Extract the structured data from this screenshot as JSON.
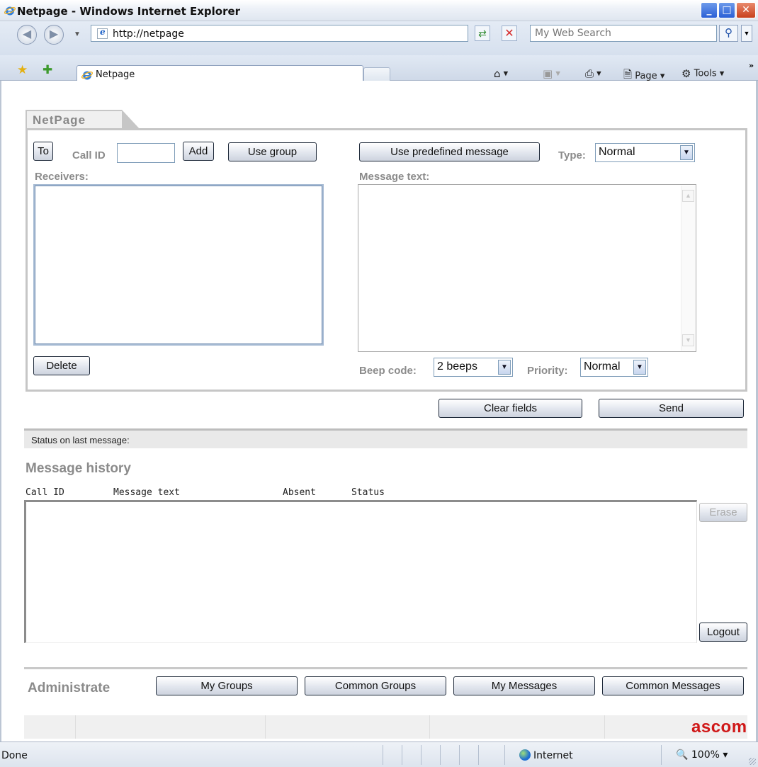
{
  "window": {
    "title": "Netpage - Windows Internet Explorer",
    "min_glyph": "_",
    "max_glyph": "□",
    "close_glyph": "✕"
  },
  "address": {
    "url": "http://netpage",
    "search_placeholder": "My Web Search"
  },
  "tabs": [
    {
      "label": "Netpage"
    }
  ],
  "commands": {
    "page": "Page",
    "tools": "Tools"
  },
  "app": {
    "tab_label": "NetPage",
    "to_button": "To",
    "call_id_label": "Call ID",
    "call_id_value": "",
    "add_button": "Add",
    "use_group_button": "Use group",
    "receivers_label": "Receivers:",
    "delete_button": "Delete",
    "predefined_button": "Use predefined message",
    "type_label": "Type:",
    "type_value": "Normal",
    "message_label": "Message text:",
    "message_value": "",
    "beep_label": "Beep code:",
    "beep_value": "2 beeps",
    "priority_label": "Priority:",
    "priority_value": "Normal",
    "clear_button": "Clear fields",
    "send_button": "Send",
    "status_label": "Status on last message:",
    "history_title": "Message history",
    "history_columns": [
      "Call ID",
      "Message text",
      "Absent",
      "Status"
    ],
    "erase_button": "Erase",
    "logout_button": "Logout",
    "administrate_label": "Administrate",
    "admin_buttons": [
      "My Groups",
      "Common Groups",
      "My Messages",
      "Common Messages"
    ],
    "logo_text": "ascom"
  },
  "statusbar": {
    "text": "Done",
    "zone": "Internet",
    "zoom": "100%"
  },
  "colors": {
    "label_gray": "#8b8b8b",
    "logo_red": "#d01818",
    "tab_border": "#c6c6c6"
  }
}
